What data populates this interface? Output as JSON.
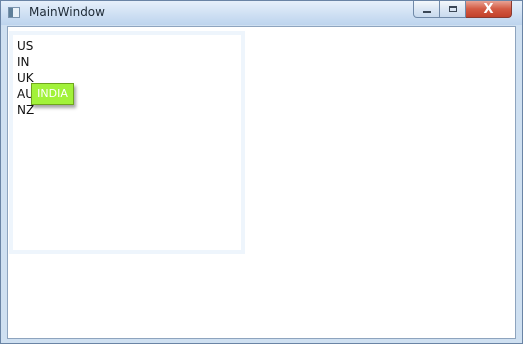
{
  "window": {
    "title": "MainWindow"
  },
  "caption_buttons": {
    "close_label": "X"
  },
  "listbox": {
    "items": [
      "US",
      "IN",
      "UK",
      "AU",
      "NZ"
    ]
  },
  "tooltip": {
    "text": "INDIA"
  }
}
